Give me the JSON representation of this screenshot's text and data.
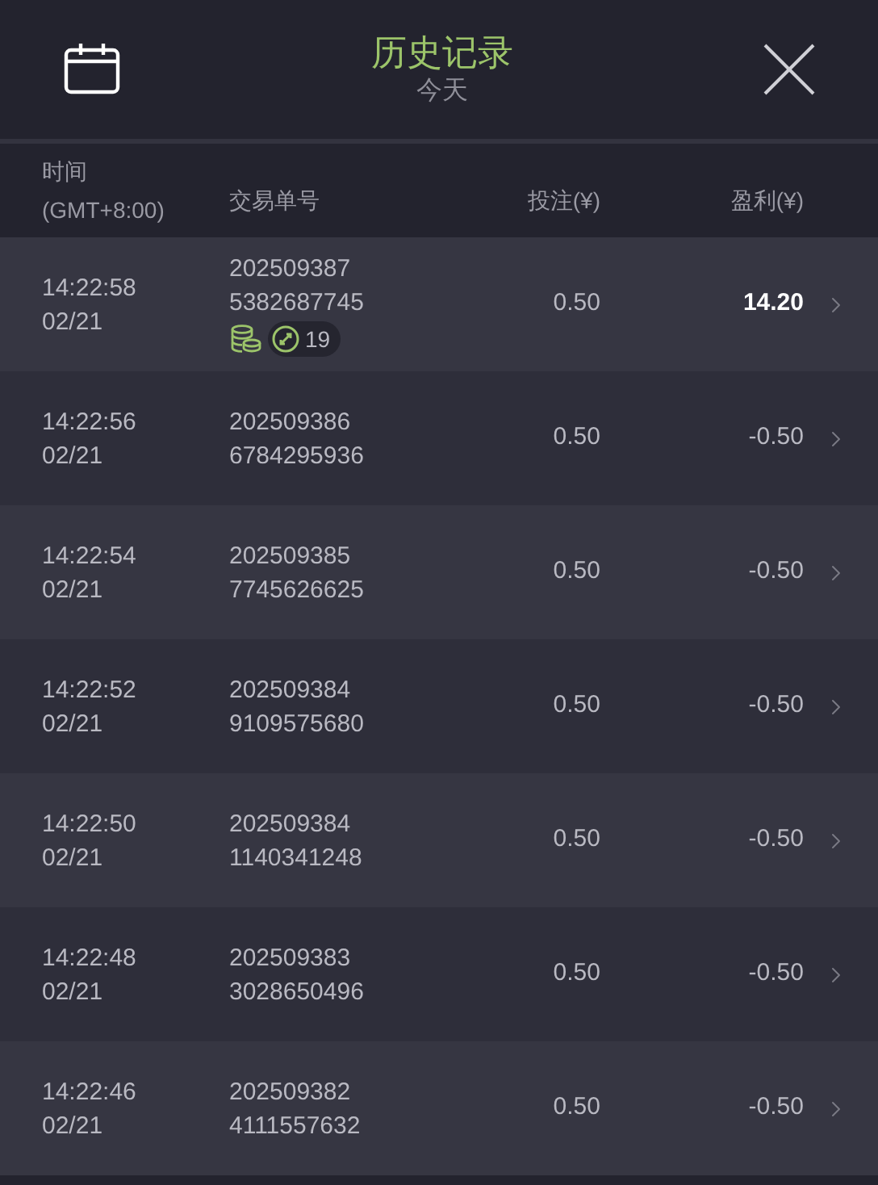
{
  "header": {
    "title": "历史记录",
    "subtitle": "今天"
  },
  "columns": {
    "time": "时间",
    "timezone": "(GMT+8:00)",
    "order": "交易单号",
    "stake": "投注(¥)",
    "profit": "盈利(¥)"
  },
  "rows": [
    {
      "time": "14:22:58",
      "date": "02/21",
      "order_1": "202509387",
      "order_2": "5382687745",
      "stake": "0.50",
      "profit": "14.20",
      "won": true,
      "bonus": {
        "count": "19"
      }
    },
    {
      "time": "14:22:56",
      "date": "02/21",
      "order_1": "202509386",
      "order_2": "6784295936",
      "stake": "0.50",
      "profit": "-0.50",
      "won": false
    },
    {
      "time": "14:22:54",
      "date": "02/21",
      "order_1": "202509385",
      "order_2": "7745626625",
      "stake": "0.50",
      "profit": "-0.50",
      "won": false
    },
    {
      "time": "14:22:52",
      "date": "02/21",
      "order_1": "202509384",
      "order_2": "9109575680",
      "stake": "0.50",
      "profit": "-0.50",
      "won": false
    },
    {
      "time": "14:22:50",
      "date": "02/21",
      "order_1": "202509384",
      "order_2": "1140341248",
      "stake": "0.50",
      "profit": "-0.50",
      "won": false
    },
    {
      "time": "14:22:48",
      "date": "02/21",
      "order_1": "202509383",
      "order_2": "3028650496",
      "stake": "0.50",
      "profit": "-0.50",
      "won": false
    },
    {
      "time": "14:22:46",
      "date": "02/21",
      "order_1": "202509382",
      "order_2": "4111557632",
      "stake": "0.50",
      "profit": "-0.50",
      "won": false
    }
  ]
}
